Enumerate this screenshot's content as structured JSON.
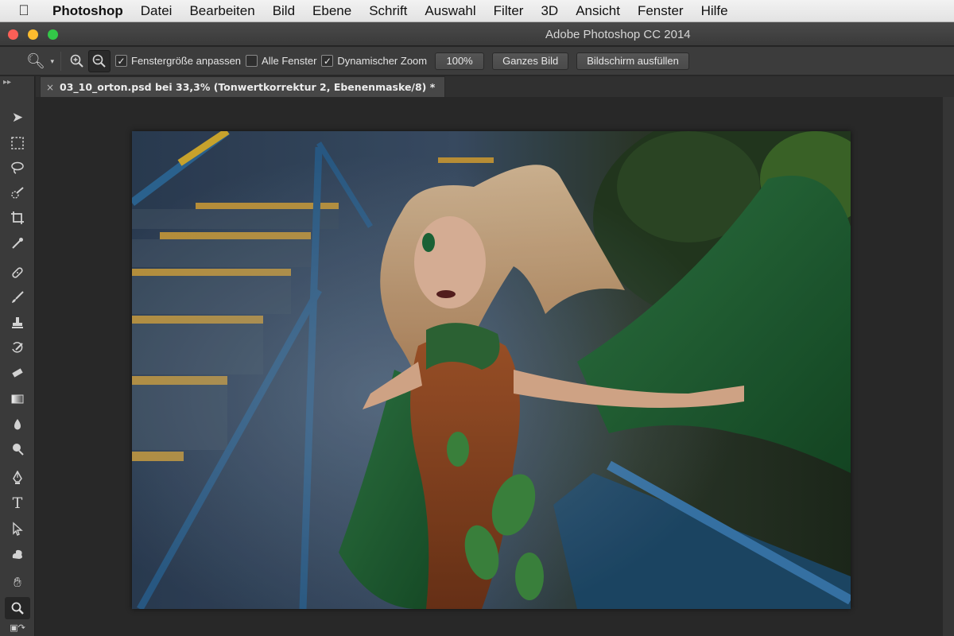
{
  "menubar": {
    "apple_icon": "apple-icon",
    "app": "Photoshop",
    "items": [
      "Datei",
      "Bearbeiten",
      "Bild",
      "Ebene",
      "Schrift",
      "Auswahl",
      "Filter",
      "3D",
      "Ansicht",
      "Fenster",
      "Hilfe"
    ]
  },
  "window": {
    "title": "Adobe Photoshop CC 2014"
  },
  "options": {
    "fit_window_label": "Fenstergröße anpassen",
    "fit_window_checked": true,
    "all_windows_label": "Alle Fenster",
    "all_windows_checked": false,
    "dynamic_zoom_label": "Dynamischer Zoom",
    "dynamic_zoom_checked": true,
    "pct_button": "100%",
    "fit_screen_button": "Ganzes Bild",
    "fill_screen_button": "Bildschirm ausfüllen"
  },
  "document": {
    "tab_title": "03_10_orton.psd bei 33,3% (Tonwertkorrektur 2, Ebenenmaske/8) *",
    "close_glyph": "×"
  },
  "colors": {
    "accent_close": "#fc5f57",
    "accent_min": "#fdbc2e",
    "accent_max": "#33c748"
  }
}
